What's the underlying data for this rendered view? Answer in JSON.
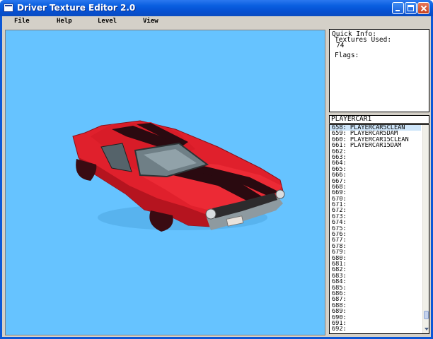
{
  "window": {
    "title": "Driver Texture Editor 2.0"
  },
  "menu": {
    "file": "File",
    "help": "Help",
    "level": "Level",
    "view": "View"
  },
  "quick_info": {
    "title": "Quick Info:",
    "textures_label": "Textures Used:",
    "textures_value": "74",
    "flags_label": "Flags:"
  },
  "name_field": {
    "value": "PLAYERCAR1"
  },
  "texture_list": {
    "items": [
      "658: PLAYERCAR5CLEAN",
      "659: PLAYERCAR5DAM",
      "660: PLAYERCAR15CLEAN",
      "661: PLAYERCAR15DAM",
      "662:",
      "663:",
      "664:",
      "665:",
      "666:",
      "667:",
      "668:",
      "669:",
      "670:",
      "671:",
      "672:",
      "673:",
      "674:",
      "675:",
      "676:",
      "677:",
      "678:",
      "679:",
      "680:",
      "681:",
      "682:",
      "683:",
      "684:",
      "685:",
      "686:",
      "687:",
      "688:",
      "689:",
      "690:",
      "691:",
      "692:"
    ],
    "selected_index": 0
  },
  "viewport": {
    "background_color": "#66c3ff",
    "model_body_color": "#e0202c",
    "model_stripe_color": "#2a0a10"
  }
}
